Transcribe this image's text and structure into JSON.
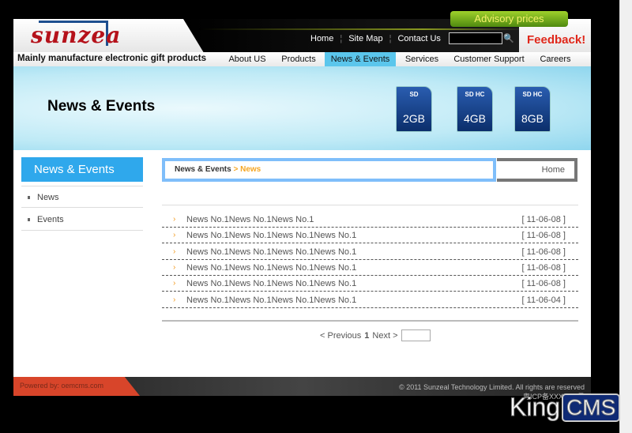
{
  "header": {
    "logo_text": "sunzea",
    "advisory": "Advisory prices",
    "links": [
      "Home",
      "Site Map",
      "Contact Us"
    ],
    "search_placeholder": "",
    "feedback": "Feedback!",
    "slogan": "Mainly manufacture electronic gift products"
  },
  "nav": [
    {
      "label": "About US"
    },
    {
      "label": "Products"
    },
    {
      "label": "News & Events",
      "active": true
    },
    {
      "label": "Services"
    },
    {
      "label": "Customer Support"
    },
    {
      "label": "Careers"
    }
  ],
  "banner": {
    "title": "News & Events",
    "cards": [
      {
        "cap": "2GB",
        "type": "SD"
      },
      {
        "cap": "4GB",
        "type": "SD HC"
      },
      {
        "cap": "8GB",
        "type": "SD HC"
      }
    ]
  },
  "sidebar": {
    "title": "News & Events",
    "items": [
      "News",
      "Events"
    ]
  },
  "breadcrumb": {
    "parent": "News & Events",
    "current": "> News",
    "home": "Home"
  },
  "news": [
    {
      "title": "News No.1News No.1News No.1",
      "date": "[ 11-06-08 ]"
    },
    {
      "title": "News No.1News No.1News No.1News No.1",
      "date": "[ 11-06-08 ]"
    },
    {
      "title": "News No.1News No.1News No.1News No.1",
      "date": "[ 11-06-08 ]"
    },
    {
      "title": "News No.1News No.1News No.1News No.1",
      "date": "[ 11-06-08 ]"
    },
    {
      "title": "News No.1News No.1News No.1News No.1",
      "date": "[ 11-06-08 ]"
    },
    {
      "title": "News No.1News No.1News No.1News No.1",
      "date": "[ 11-06-04 ]"
    }
  ],
  "pager": {
    "prev": "< Previous",
    "page": "1",
    "next": "Next >"
  },
  "footer": {
    "powered": "Powered by: oemcms.com",
    "copyright": "© 2011 Sunzeal Technology Limited. All rights are reserved",
    "icp": "粤ICP备XXXXXX号"
  },
  "watermark": {
    "king": "King",
    "cms": "CMS"
  }
}
